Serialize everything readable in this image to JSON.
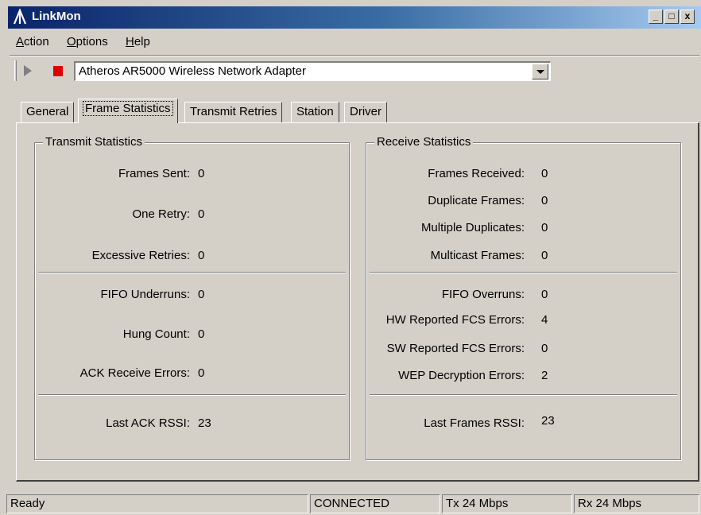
{
  "window": {
    "title": "LinkMon",
    "minimize_label": "_",
    "restore_label": "□",
    "close_label": "x"
  },
  "menubar": [
    {
      "label": "Action",
      "mnemonic": "A",
      "rest": "ction"
    },
    {
      "label": "Options",
      "mnemonic": "O",
      "rest": "ptions"
    },
    {
      "label": "Help",
      "mnemonic": "H",
      "rest": "elp"
    }
  ],
  "toolbar": {
    "adapter_selected": "Atheros AR5000 Wireless Network Adapter",
    "play_icon": "play-icon",
    "stop_icon": "stop-icon",
    "stop_color": "#e00000"
  },
  "tabs": [
    {
      "label": "General",
      "active": false
    },
    {
      "label": "Frame Statistics",
      "active": true
    },
    {
      "label": "Transmit Retries",
      "active": false
    },
    {
      "label": "Station",
      "active": false
    },
    {
      "label": "Driver",
      "active": false
    }
  ],
  "transmit": {
    "title": "Transmit Statistics",
    "stats": [
      {
        "label": "Frames Sent:",
        "value": "0"
      },
      {
        "label": "One Retry:",
        "value": "0"
      },
      {
        "label": "Excessive Retries:",
        "value": "0"
      },
      {
        "label": "FIFO Underruns:",
        "value": "0"
      },
      {
        "label": "Hung Count:",
        "value": "0"
      },
      {
        "label": "ACK Receive Errors:",
        "value": "0"
      },
      {
        "label": "Last ACK RSSI:",
        "value": "23"
      }
    ]
  },
  "receive": {
    "title": "Receive Statistics",
    "stats": [
      {
        "label": "Frames Received:",
        "value": "0"
      },
      {
        "label": "Duplicate Frames:",
        "value": "0"
      },
      {
        "label": "Multiple Duplicates:",
        "value": "0"
      },
      {
        "label": "Multicast Frames:",
        "value": "0"
      },
      {
        "label": "FIFO Overruns:",
        "value": "0"
      },
      {
        "label": "HW Reported FCS Errors:",
        "value": "4"
      },
      {
        "label": "SW Reported FCS Errors:",
        "value": "0"
      },
      {
        "label": "WEP Decryption Errors:",
        "value": "2"
      },
      {
        "label": "Last Frames RSSI:",
        "value": "23"
      }
    ]
  },
  "statusbar": {
    "state": "Ready",
    "connection": "CONNECTED",
    "tx": "Tx 24 Mbps",
    "rx": "Rx 24 Mbps"
  },
  "colors": {
    "title_gradient_start": "#0a246a",
    "title_gradient_end": "#a6caf0",
    "face": "#d4d0c8"
  }
}
